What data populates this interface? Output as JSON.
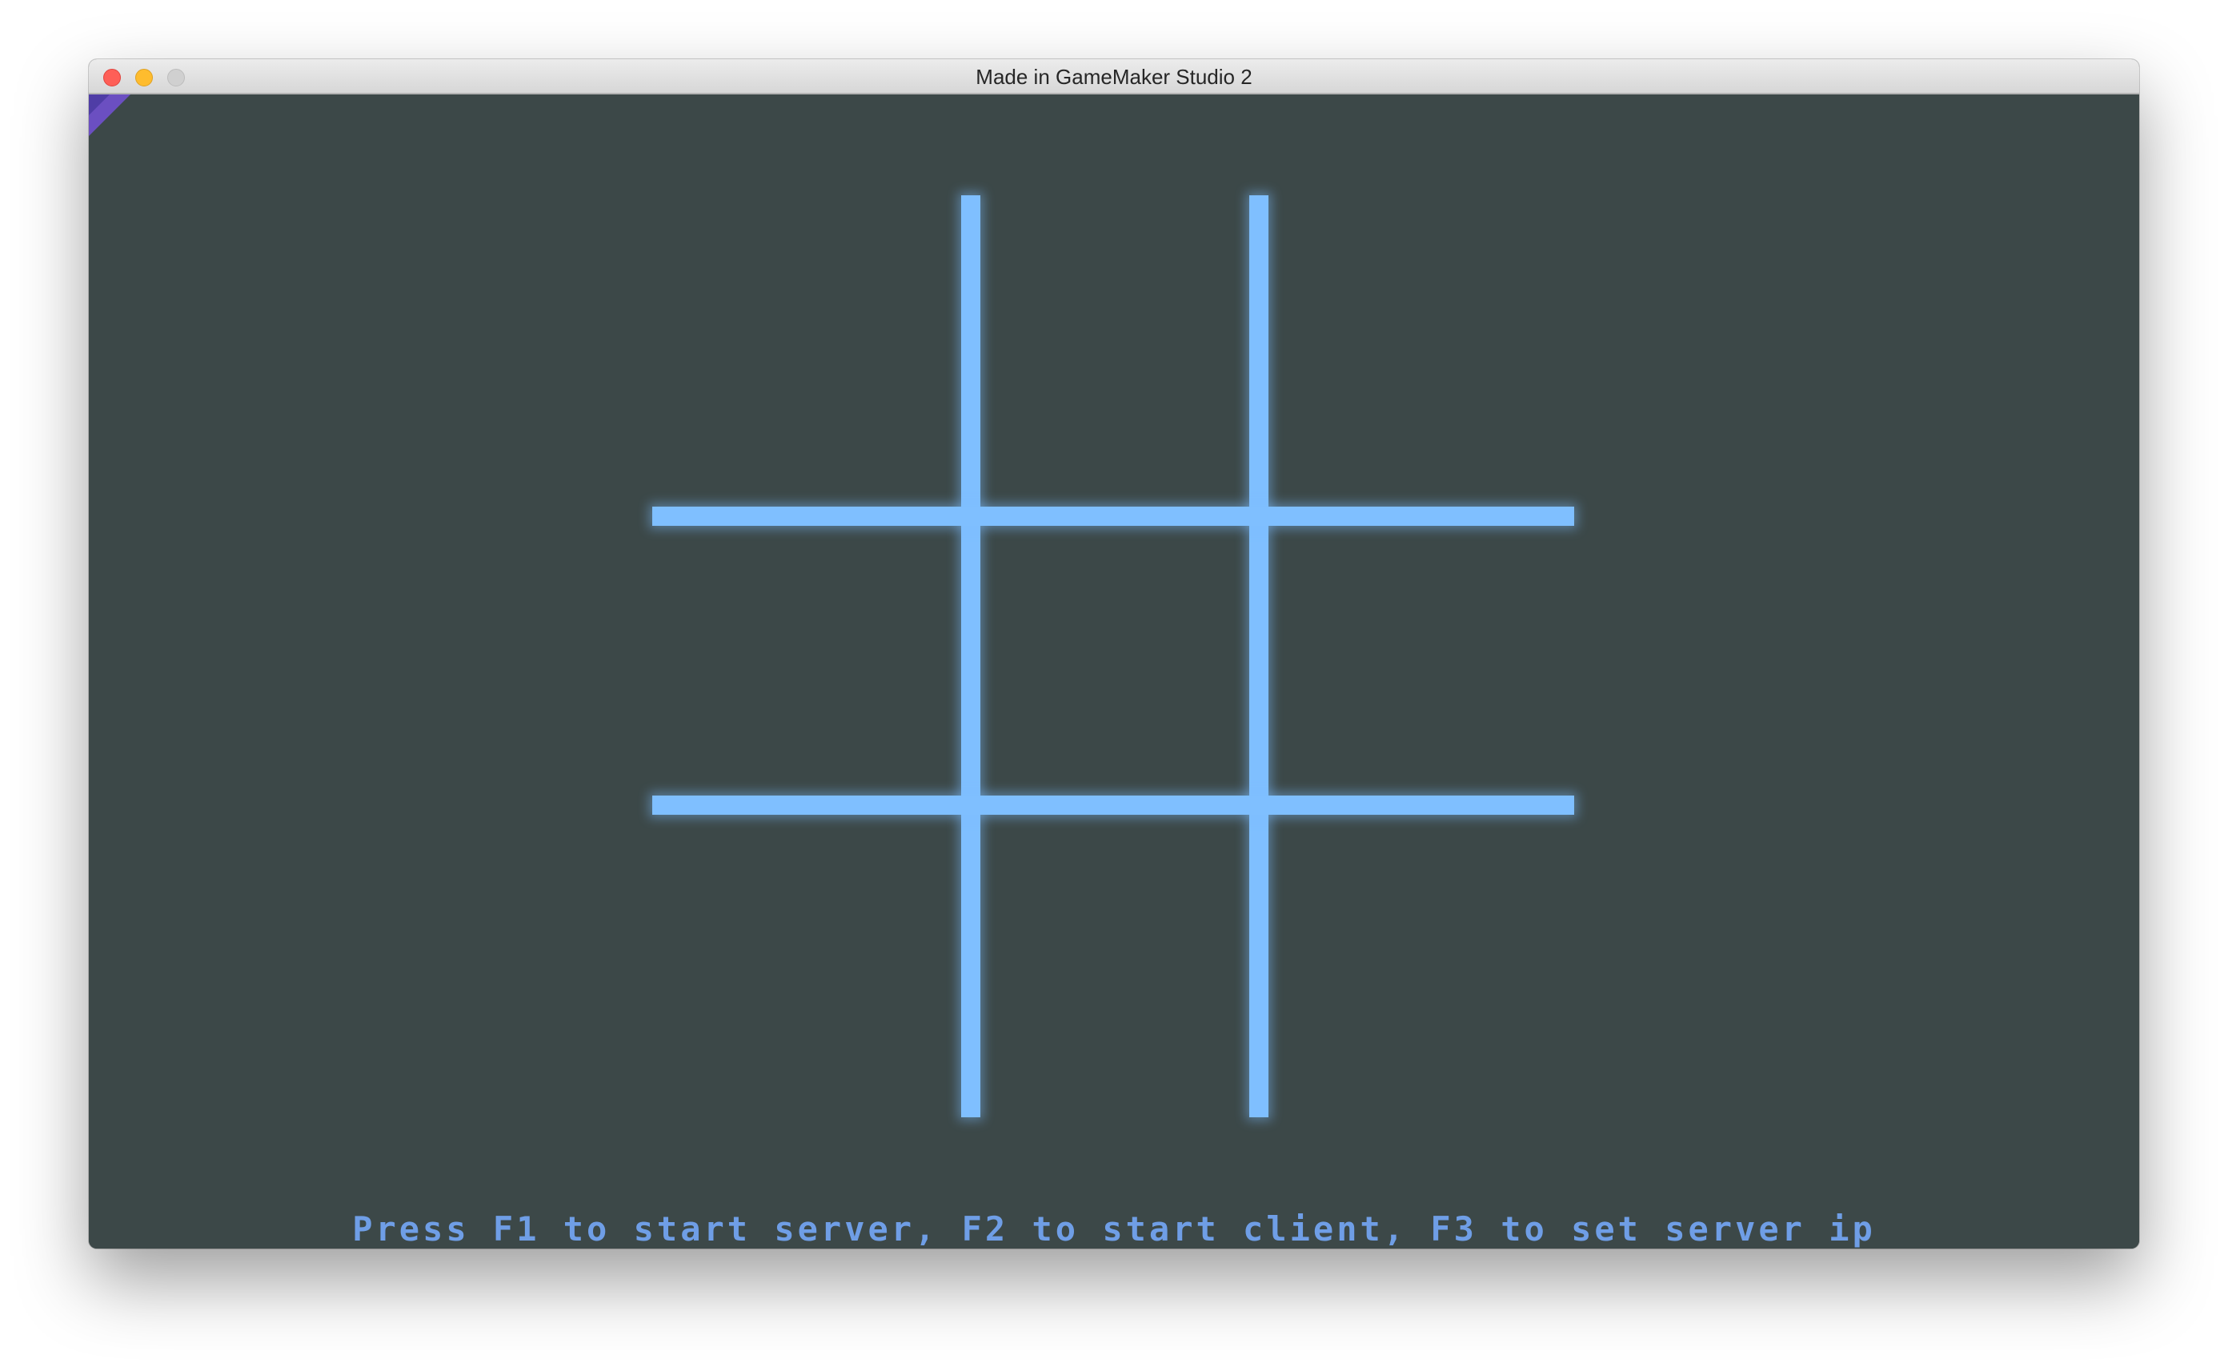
{
  "window": {
    "title": "Made in GameMaker Studio 2",
    "controls": [
      "close",
      "minimize",
      "maximize"
    ]
  },
  "game": {
    "background_color": "#3c4848",
    "grid_color": "#7fbfff",
    "board": {
      "rows": 3,
      "cols": 3,
      "cells": [
        "",
        "",
        "",
        "",
        "",
        "",
        "",
        "",
        ""
      ]
    },
    "prompt": "Press F1 to start server, F2 to start client, F3 to set server ip",
    "prompt_color": "#6f9ee6"
  }
}
